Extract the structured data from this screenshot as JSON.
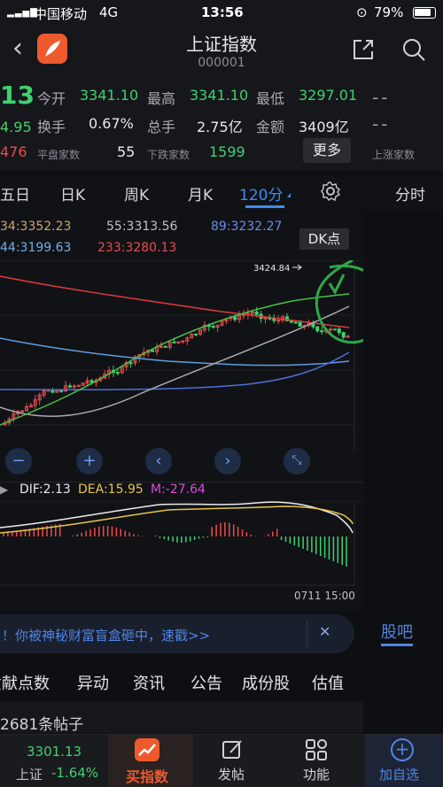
{
  "status_bar": {
    "carrier": "中国移动",
    "network": "4G",
    "time": "13:56",
    "battery": "79%"
  },
  "header": {
    "title": "上证指数",
    "code": "000001"
  },
  "quote": {
    "price_partial": "13",
    "change_partial": "4.95",
    "pct_partial": "476",
    "open_label": "今开",
    "open": "3341.10",
    "high_label": "最高",
    "high": "3341.10",
    "low_label": "最低",
    "low": "3297.01",
    "turnover_label": "换手",
    "turnover": "0.67%",
    "volume_label": "总手",
    "volume": "2.75亿",
    "amount_label": "金额",
    "amount": "3409亿",
    "flat_label": "平盘家数",
    "flat": "55",
    "down_label": "下跌家数",
    "down": "1599",
    "more_label": "更多",
    "dash": "--",
    "up_label": "上涨家数"
  },
  "period_tabs": {
    "items": [
      "五日",
      "日K",
      "周K",
      "月K",
      "120分"
    ],
    "active": "120分",
    "time_share": "分时"
  },
  "ma_legend": {
    "ma34": "34:3352.23",
    "ma55": "55:3313.56",
    "ma89": "89:3232.27",
    "ma144": "44:3199.63",
    "ma233": "233:3280.13",
    "dk_label": "DK点",
    "peak_label": "3424.84"
  },
  "macd": {
    "dif": "DIF:2.13",
    "dea": "DEA:15.95",
    "m": "M:-27.64",
    "timestamp": "0711 15:00"
  },
  "colors": {
    "up": "#ee4b4b",
    "down": "#3fd170",
    "accent": "#3d8cf0",
    "bg": "#111216"
  },
  "ad_banner": {
    "text": "！你被神秘财富盲盒砸中，速戳>>",
    "side_tab": "股吧"
  },
  "info_tabs": [
    "贡献点数",
    "异动",
    "资讯",
    "公告",
    "成份股",
    "估值"
  ],
  "posts": {
    "text": "2681条帖子"
  },
  "bottom_bar": {
    "index_price": "3301.13",
    "index_name": "上证",
    "index_change": "-1.64%",
    "buy_label": "买指数",
    "post_label": "发帖",
    "function_label": "功能",
    "watchlist_label": "加自选"
  }
}
